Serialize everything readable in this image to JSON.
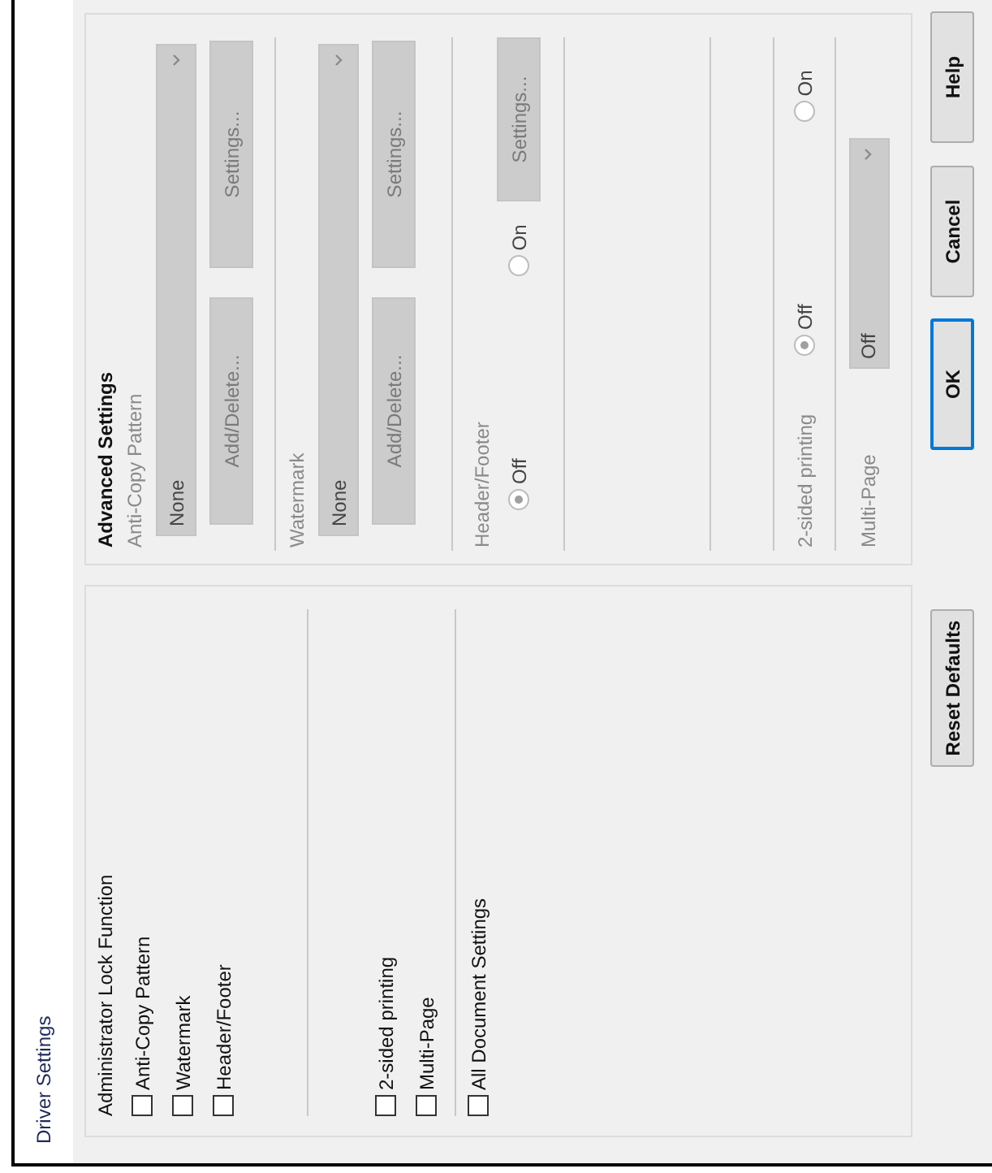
{
  "window": {
    "title": "Driver Settings"
  },
  "lock_panel": {
    "title": "Administrator Lock Function",
    "groups": [
      {
        "items": [
          {
            "label": "Anti-Copy Pattern",
            "checked": false
          },
          {
            "label": "Watermark",
            "checked": false
          },
          {
            "label": "Header/Footer",
            "checked": false
          }
        ]
      },
      {
        "items": [
          {
            "label": "2-sided printing",
            "checked": false
          },
          {
            "label": "Multi-Page",
            "checked": false
          }
        ]
      },
      {
        "items": [
          {
            "label": "All Document Settings",
            "checked": false
          }
        ]
      }
    ]
  },
  "advanced": {
    "title": "Advanced Settings",
    "disabled": true,
    "sections": [
      {
        "kind": "select",
        "label": "Anti-Copy Pattern",
        "value": "None",
        "buttons": [
          "Add/Delete...",
          "Settings..."
        ]
      },
      {
        "kind": "select",
        "label": "Watermark",
        "value": "None",
        "buttons": [
          "Add/Delete...",
          "Settings..."
        ]
      },
      {
        "kind": "radio",
        "label": "Header/Footer",
        "options": [
          {
            "label": "Off",
            "selected": true
          },
          {
            "label": "On",
            "selected": false
          }
        ],
        "button": "Settings..."
      },
      {
        "kind": "radio",
        "label": "2-sided printing",
        "options": [
          {
            "label": "Off",
            "selected": true
          },
          {
            "label": "On",
            "selected": false
          }
        ]
      },
      {
        "kind": "inline_select",
        "label": "Multi-Page",
        "value": "Off"
      }
    ]
  },
  "buttons": [
    {
      "label": "Reset Defaults",
      "focused": false
    },
    {
      "label": "OK",
      "focused": true
    },
    {
      "label": "Cancel",
      "focused": false
    },
    {
      "label": "Help",
      "focused": false
    }
  ]
}
